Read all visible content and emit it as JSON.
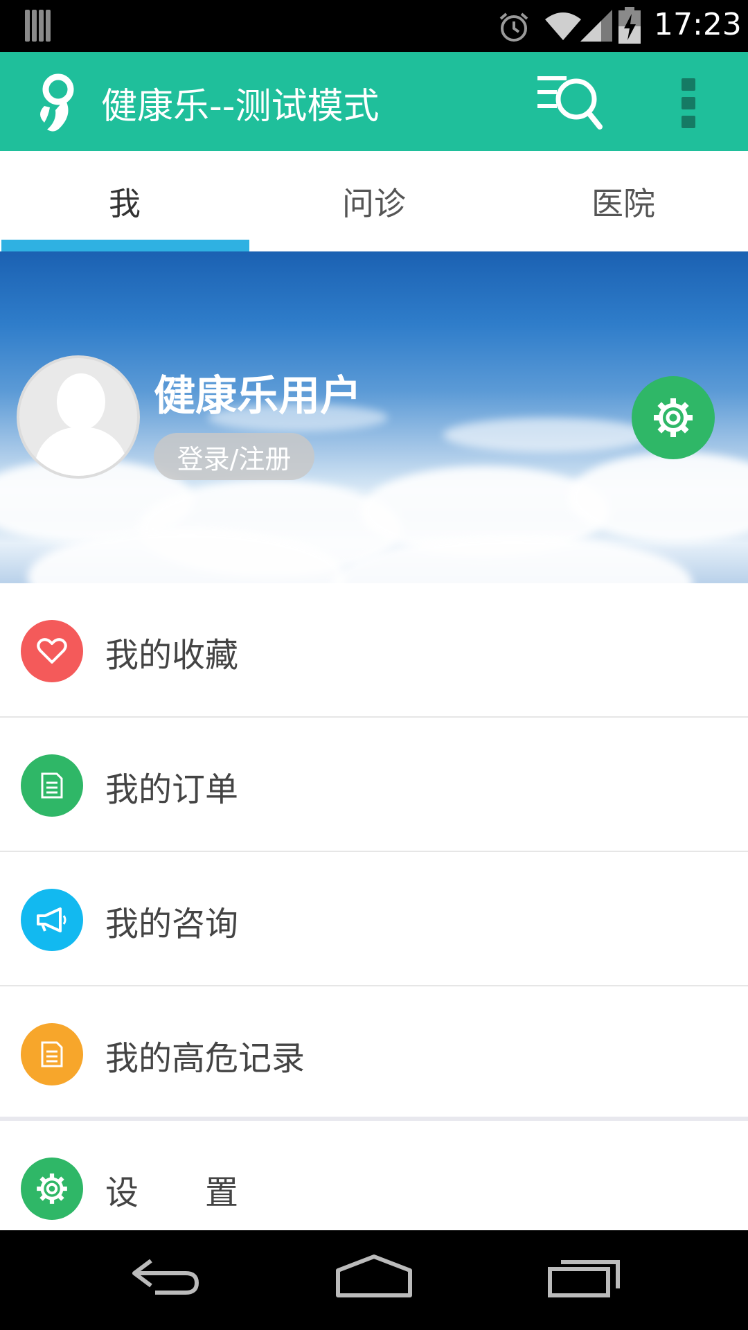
{
  "status_bar": {
    "time": "17:23",
    "icons": [
      "notification-bars-icon",
      "alarm-icon",
      "wifi-icon",
      "signal-icon",
      "battery-charging-icon"
    ]
  },
  "app_bar": {
    "title": "健康乐--测试模式",
    "logo": "app-logo",
    "actions": [
      "search-list-icon",
      "overflow-menu-icon"
    ],
    "color": "#1fbf9b"
  },
  "tabs": [
    {
      "label": "我",
      "active": true
    },
    {
      "label": "问诊",
      "active": false
    },
    {
      "label": "医院",
      "active": false
    }
  ],
  "tab_indicator_color": "#2fb1e2",
  "profile": {
    "user_name": "健康乐用户",
    "login_label": "登录/注册",
    "avatar": "default-avatar",
    "settings_icon": "gear-icon"
  },
  "menu": {
    "items": [
      {
        "label": "我的收藏",
        "icon": "heart-icon",
        "color": "#f45a5a"
      },
      {
        "label": "我的订单",
        "icon": "document-icon",
        "color": "#2fb767"
      },
      {
        "label": "我的咨询",
        "icon": "megaphone-icon",
        "color": "#12b9f0"
      },
      {
        "label": "我的高危记录",
        "icon": "record-icon",
        "color": "#f7a62b"
      },
      {
        "label": "设　　置",
        "icon": "gear-icon",
        "color": "#2fb767"
      }
    ]
  },
  "nav_bar": {
    "buttons": [
      "back-icon",
      "home-icon",
      "recents-icon"
    ]
  }
}
